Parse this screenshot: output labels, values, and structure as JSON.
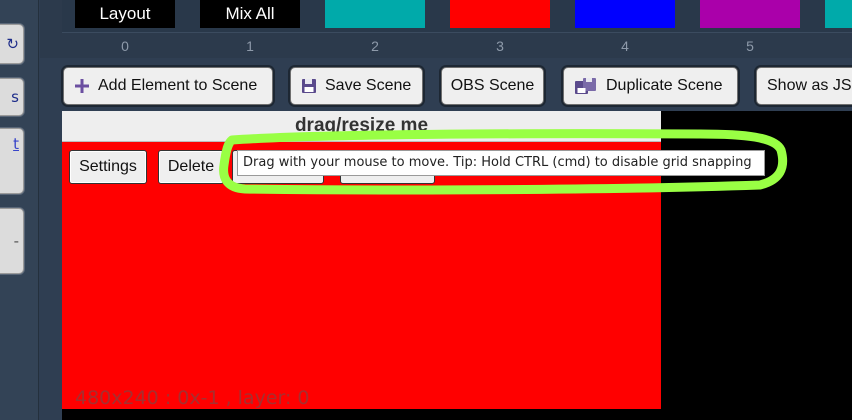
{
  "sidebar": {
    "items": [
      {
        "glyph": "↻",
        "icon": "refresh-icon"
      },
      {
        "glyph": "s",
        "icon": "settings-icon"
      },
      {
        "label": "t"
      },
      {
        "glyph": "-",
        "icon": "dash-icon"
      }
    ]
  },
  "scenes": [
    {
      "label": "Layout",
      "number": "0",
      "color": "#000000"
    },
    {
      "label": "Mix All",
      "number": "1",
      "color": "#000000"
    },
    {
      "label": "",
      "number": "2",
      "color": "#00aaaa"
    },
    {
      "label": "",
      "number": "3",
      "color": "#ff0000"
    },
    {
      "label": "",
      "number": "4",
      "color": "#0000ff"
    },
    {
      "label": "",
      "number": "5",
      "color": "#aa00aa"
    },
    {
      "label": "",
      "number": "",
      "color": "#00aaaa"
    }
  ],
  "toolbar": {
    "add_element": "Add Element to Scene",
    "save_scene": "Save Scene",
    "obs_scene": "OBS Scene",
    "duplicate_scene": "Duplicate Scene",
    "show_as_json": "Show as JS"
  },
  "element": {
    "title": "drag/resize me",
    "settings_label": "Settings",
    "delete_label": "Delete",
    "info": "480x240 : 0x-1 , layer: 0",
    "background_color": "#ff0000"
  },
  "tooltip": {
    "text": "Drag with your mouse to move. Tip: Hold CTRL (cmd) to disable grid snapping"
  },
  "colors": {
    "canvas": "#000000",
    "highlight": "#99ff44",
    "add_icon": "#6b4fa0",
    "save_icon": "#6b4fa0"
  }
}
